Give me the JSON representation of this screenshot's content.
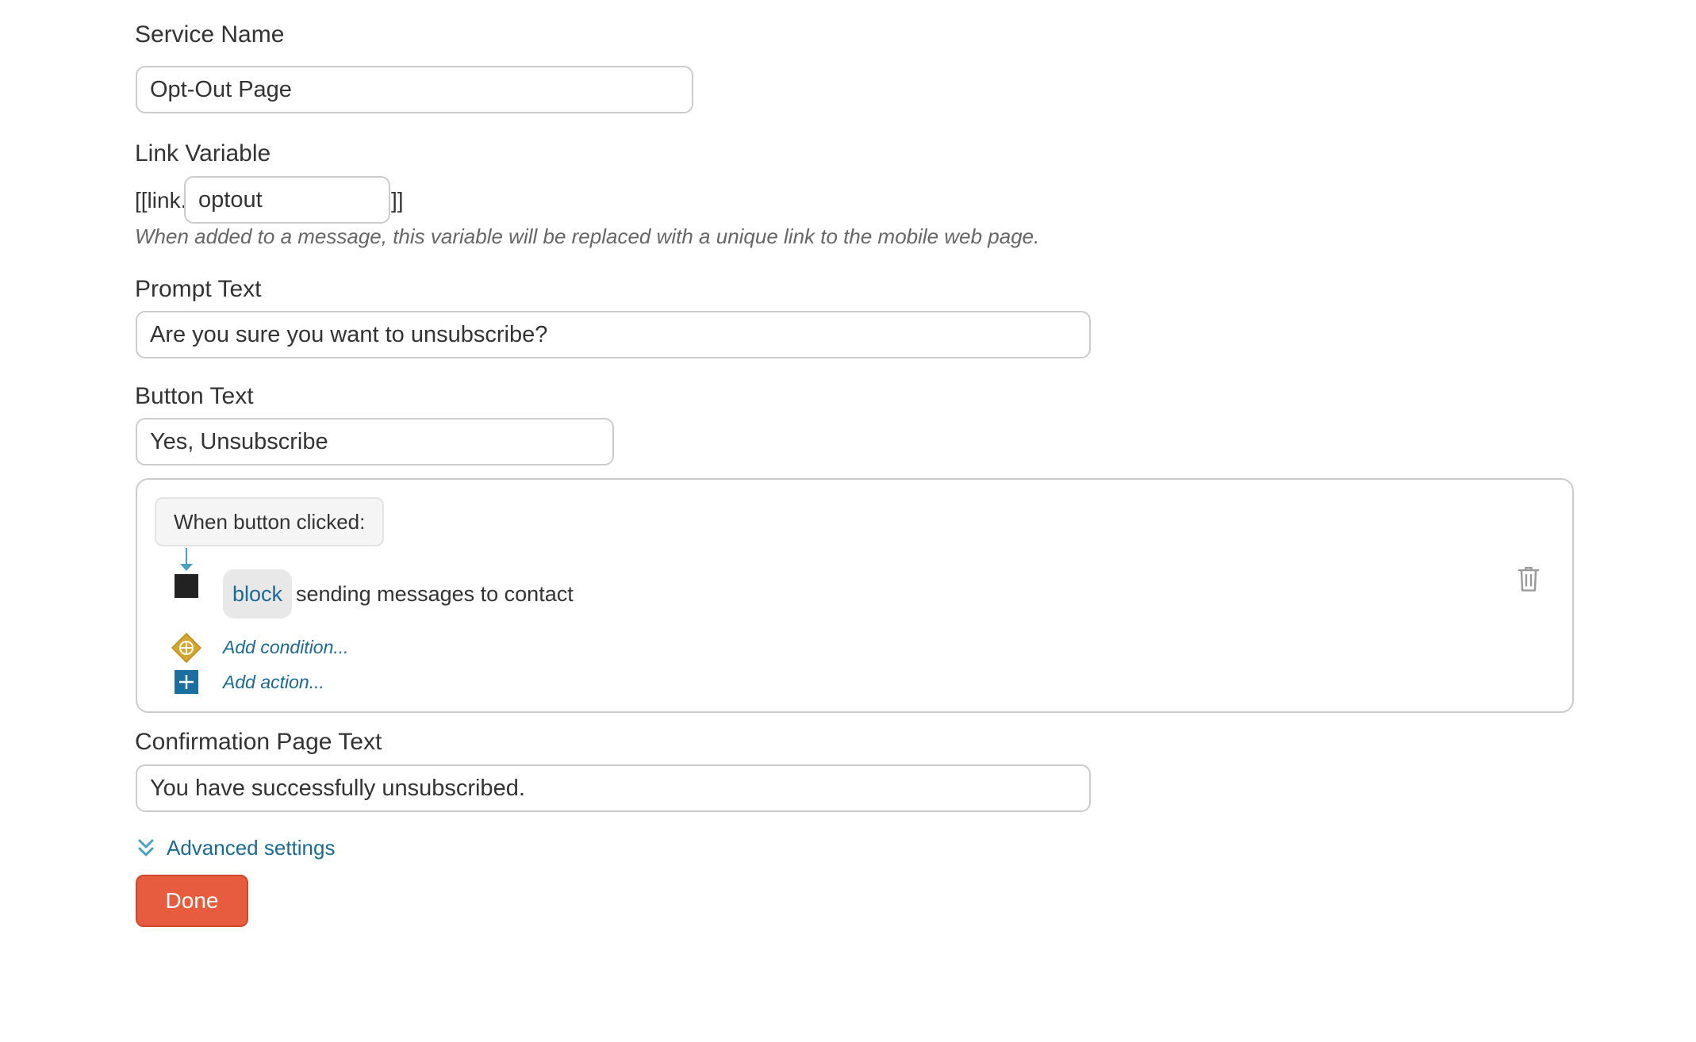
{
  "service_name": {
    "label": "Service Name",
    "value": "Opt-Out Page"
  },
  "link_variable": {
    "label": "Link Variable",
    "prefix": "[[link.",
    "value": "optout",
    "suffix": "]]",
    "hint": "When added to a message, this variable will be replaced with a unique link to the mobile web page."
  },
  "prompt_text": {
    "label": "Prompt Text",
    "value": "Are you sure you want to unsubscribe?"
  },
  "button_text": {
    "label": "Button Text",
    "value": "Yes, Unsubscribe"
  },
  "rule": {
    "trigger": "When button clicked:",
    "action_verb": "block",
    "action_rest": "sending messages to contact",
    "add_condition": "Add condition...",
    "add_action": "Add action...",
    "icons": {
      "delete": "trash-icon",
      "condition": "diamond-plus-icon",
      "action": "square-plus-icon"
    },
    "colors": {
      "condition": "#d4a72c",
      "action": "#1a6fa0",
      "connector": "#4a9fc7"
    }
  },
  "confirmation": {
    "label": "Confirmation Page Text",
    "value": "You have successfully unsubscribed."
  },
  "advanced_settings": {
    "label": "Advanced settings",
    "icon": "double-chevron-down-icon"
  },
  "done_button": {
    "label": "Done",
    "color": "#e75c3e"
  }
}
